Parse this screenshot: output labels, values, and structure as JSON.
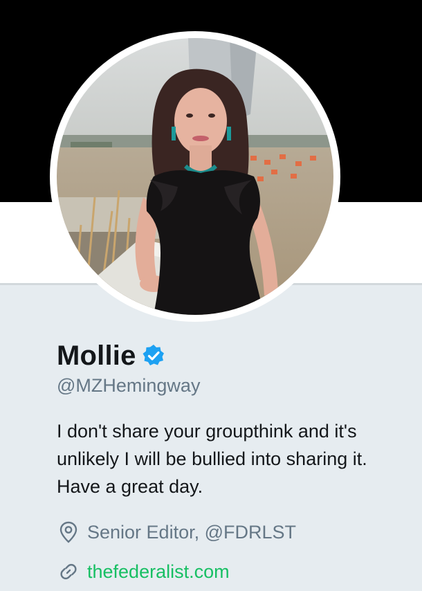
{
  "profile": {
    "display_name": "Mollie",
    "verified_icon": "verified-badge-icon",
    "handle": "@MZHemingway",
    "bio": "I don't share your groupthink and it's unlikely I will be bullied into sharing it. Have a great day.",
    "location": "Senior Editor, @FDRLST",
    "location_icon": "location-pin-icon",
    "url": "thefederalist.com",
    "url_icon": "link-icon"
  },
  "colors": {
    "banner": "#000000",
    "background": "#e6ecf0",
    "name": "#14171a",
    "secondary_text": "#657786",
    "verified": "#1da1f2",
    "link": "#17bf63"
  }
}
